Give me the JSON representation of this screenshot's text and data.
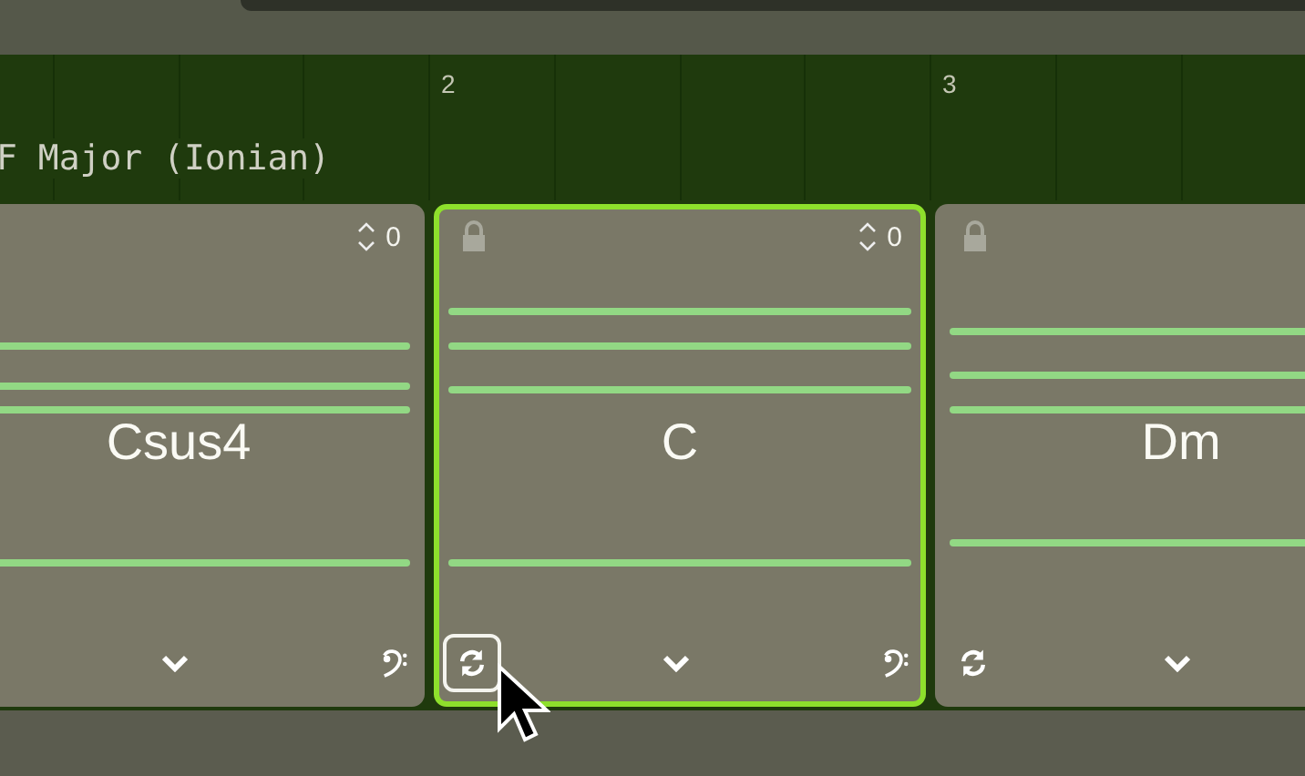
{
  "scale_label": "F Major (Ionian)",
  "bars": [
    "2",
    "3"
  ],
  "chords": [
    {
      "name": "Csus4",
      "selected": false,
      "lock_icon": false,
      "transpose": "0",
      "regenerate_icon": false,
      "bass_icon": true
    },
    {
      "name": "C",
      "selected": true,
      "lock_icon": true,
      "transpose": "0",
      "regenerate_icon": true,
      "regenerate_focused": true,
      "bass_icon": true
    },
    {
      "name": "Dm",
      "selected": false,
      "lock_icon": true,
      "regenerate_icon": true,
      "regenerate_focused": false,
      "bass_icon": false
    }
  ]
}
